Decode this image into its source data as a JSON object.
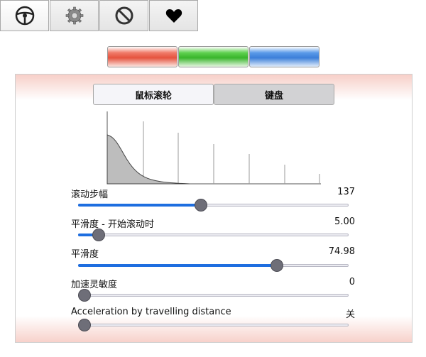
{
  "toolbar": {
    "tabs": [
      {
        "icon": "steering-wheel-icon"
      },
      {
        "icon": "gear-icon"
      },
      {
        "icon": "no-entry-icon"
      },
      {
        "icon": "heart-icon"
      }
    ]
  },
  "presets": [
    {
      "color": "#e5533e"
    },
    {
      "color": "#39b52c"
    },
    {
      "color": "#3c7fd9"
    }
  ],
  "tabs": {
    "mouse_wheel": "鼠标滚轮",
    "keyboard": "键盘"
  },
  "settings": [
    {
      "label": "滚动步幅",
      "value": "137",
      "level": 0.455
    },
    {
      "label": "平滑度 - 开始滚动时",
      "value": "5.00",
      "level": 0.075
    },
    {
      "label": "平滑度",
      "value": "74.98",
      "level": 0.735
    },
    {
      "label": "加速灵敏度",
      "value": "0",
      "level": 0.0
    },
    {
      "label": "Acceleration by travelling distance",
      "value": "关",
      "level": 0.0
    }
  ],
  "colors": {
    "accent": "#1e6ee0",
    "knob": "#6e6e78"
  }
}
